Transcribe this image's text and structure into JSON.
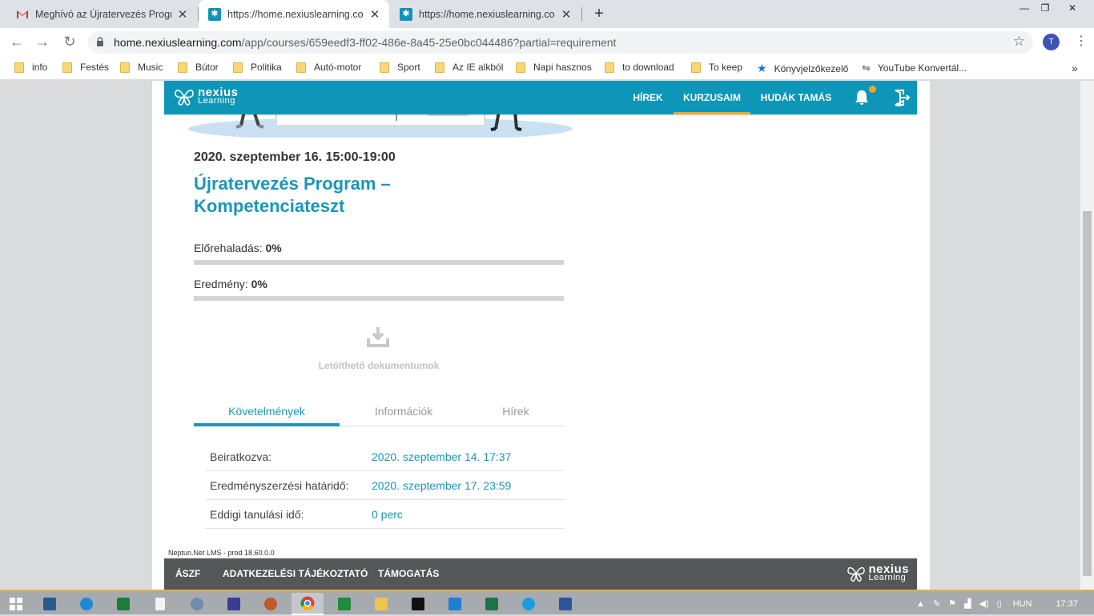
{
  "browser": {
    "tabs": [
      {
        "title": "Meghívó az Újratervezés Program",
        "icon": "gmail-icon"
      },
      {
        "title": "https://home.nexiuslearning.com",
        "icon": "nexius-icon"
      },
      {
        "title": "https://home.nexiuslearning.com",
        "icon": "nexius-icon"
      }
    ],
    "new_tab": "+",
    "url_domain": "home.nexiuslearning.com",
    "url_path": "/app/courses/659eedf3-ff02-486e-8a45-25e0bc044486?partial=requirement",
    "avatar": "T",
    "bookmarks": [
      {
        "label": "info",
        "icon": "folder-icon"
      },
      {
        "label": "Festés",
        "icon": "folder-icon"
      },
      {
        "label": "Music",
        "icon": "folder-icon"
      },
      {
        "label": "Bútor",
        "icon": "folder-icon"
      },
      {
        "label": "Politika",
        "icon": "folder-icon"
      },
      {
        "label": "Autó-motor",
        "icon": "folder-icon"
      },
      {
        "label": "Sport",
        "icon": "folder-icon"
      },
      {
        "label": "Az IE alkból",
        "icon": "folder-icon"
      },
      {
        "label": "Napi hasznos",
        "icon": "folder-icon"
      },
      {
        "label": "to download",
        "icon": "folder-icon"
      },
      {
        "label": "To keep",
        "icon": "folder-icon"
      },
      {
        "label": "Könyvjelzőkezelő",
        "icon": "star-icon"
      },
      {
        "label": "YouTube Konvertál...",
        "icon": "convert-icon"
      }
    ],
    "bookmarks_more": "»"
  },
  "header": {
    "logo_line1": "nexius",
    "logo_line2": "Learning",
    "nav": [
      "HÍREK",
      "KURZUSAIM",
      "HUDÁK TAMÁS"
    ],
    "active_nav": "KURZUSAIM",
    "accent": "#0e96b8",
    "active_color": "#f5a623"
  },
  "course": {
    "datetime": "2020. szeptember 16. 15:00-19:00",
    "title": "Újratervezés Program – Kompetenciateszt",
    "progress_label": "Előrehaladás:",
    "progress_value": "0%",
    "progress": 0,
    "result_label": "Eredmény:",
    "result_value": "0%",
    "result": 0,
    "downloads_label": "Letölthető dokumentumok"
  },
  "tabs": [
    "Követelmények",
    "Információk",
    "Hírek"
  ],
  "requirements": [
    {
      "key": "Beiratkozva:",
      "value": "2020. szeptember 14. 17:37"
    },
    {
      "key": "Eredményszerzési határidő:",
      "value": "2020. szeptember 17. 23:59"
    },
    {
      "key": "Eddigi tanulási idő:",
      "value": "0 perc"
    }
  ],
  "version": "Neptun.Net LMS - prod 18.60.0.0",
  "footer": {
    "links": [
      "ÁSZF",
      "ADATKEZELÉSI TÁJÉKOZTATÓ",
      "TÁMOGATÁS"
    ],
    "logo_line1": "nexius",
    "logo_line2": "Learning"
  },
  "taskbar": {
    "apps": [
      "windows-start-icon",
      "screen-icon",
      "ie-icon",
      "sheet-app-icon",
      "file-icon",
      "chrome-alt-icon",
      "save-icon",
      "paint-icon",
      "chrome-icon",
      "calculator-icon",
      "explorer-icon",
      "cmd-icon",
      "vscode-icon",
      "excel-icon",
      "edge-icon",
      "word-icon"
    ],
    "language": "HUN",
    "time": "17:37"
  }
}
